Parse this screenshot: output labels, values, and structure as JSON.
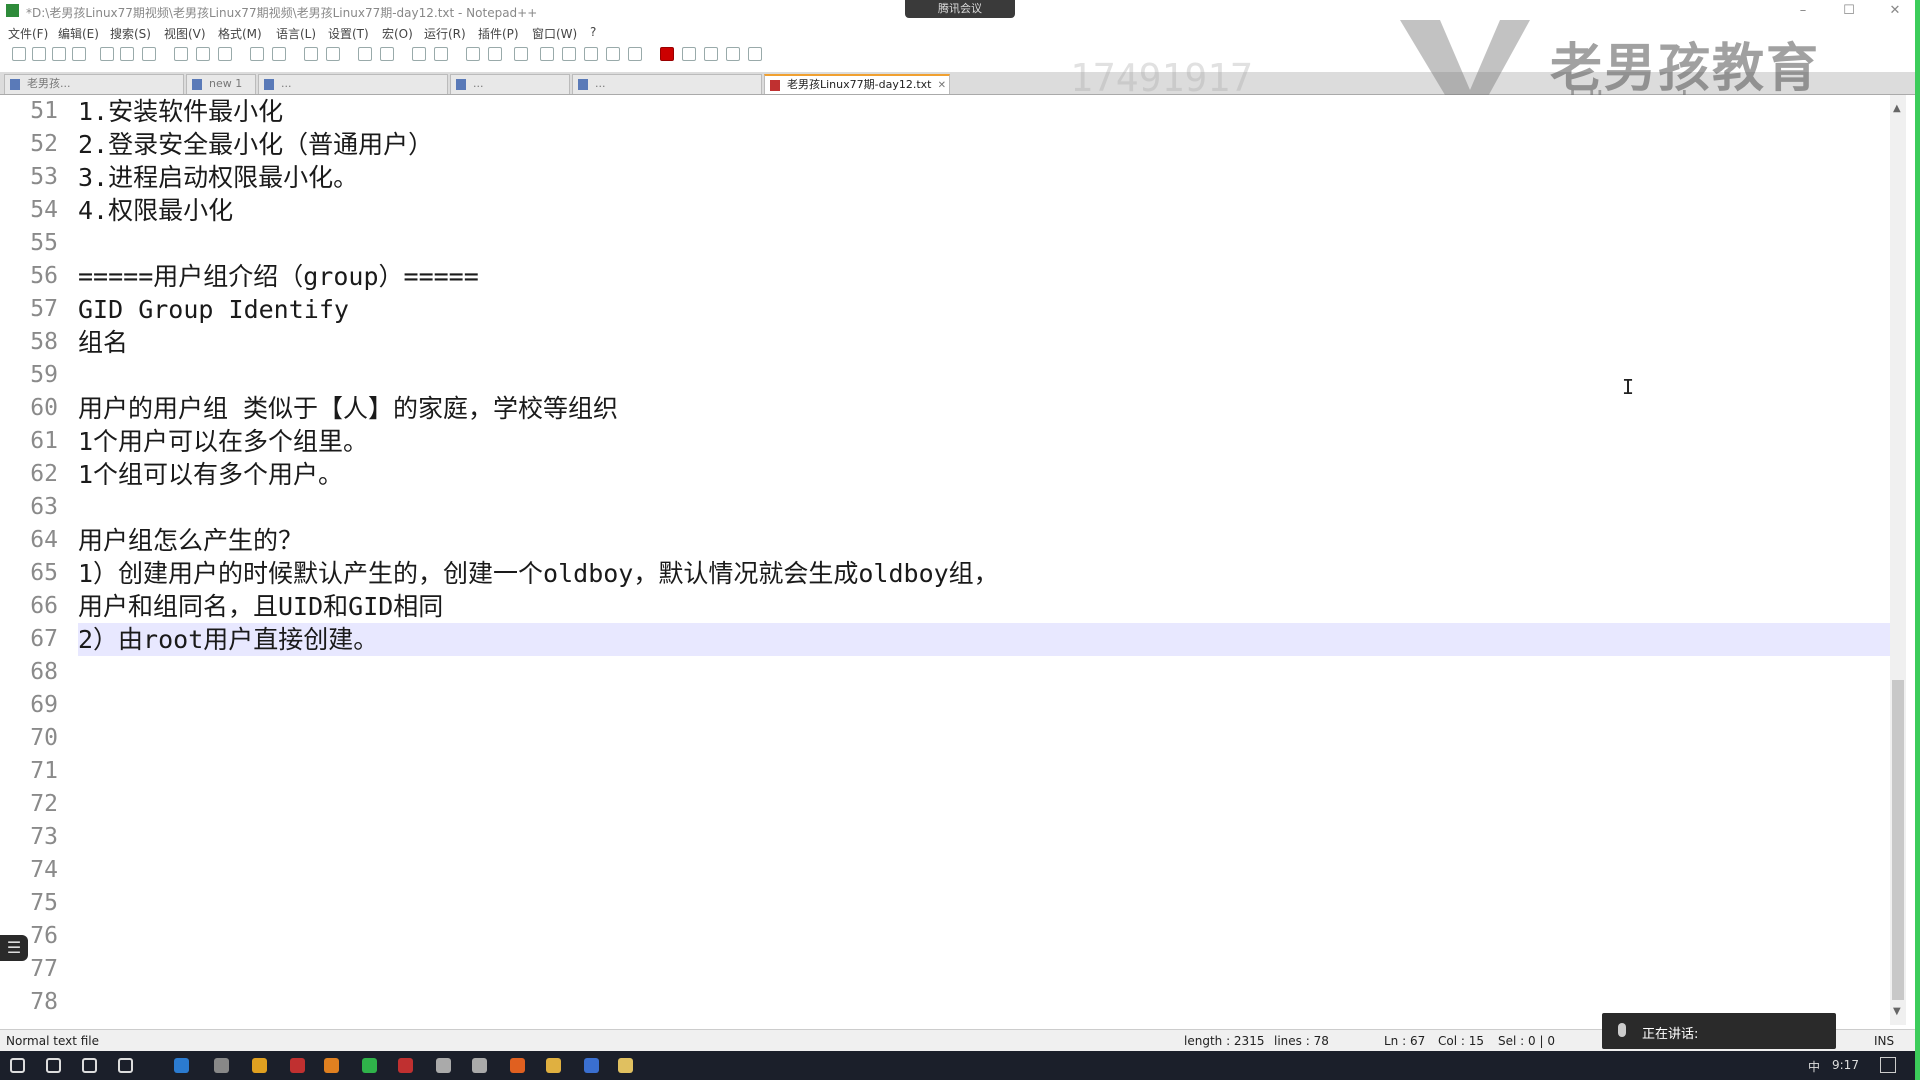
{
  "window": {
    "title": "*D:\\老男孩Linux77期视频\\老男孩Linux77期视频\\老男孩Linux77期-day12.txt - Notepad++",
    "meeting_label": "腾讯会议"
  },
  "menu": [
    "文件(F)",
    "编辑(E)",
    "搜索(S)",
    "视图(V)",
    "格式(M)",
    "语言(L)",
    "设置(T)",
    "宏(O)",
    "运行(R)",
    "插件(P)",
    "窗口(W)",
    "?"
  ],
  "tabs": [
    {
      "label": "老男孩...",
      "active": false
    },
    {
      "label": "new 1",
      "active": false
    },
    {
      "label": "...",
      "active": false
    },
    {
      "label": "...",
      "active": false
    },
    {
      "label": "...",
      "active": false
    },
    {
      "label": "老男孩Linux77期-day12.txt",
      "active": true
    }
  ],
  "watermark": {
    "brand": "老男孩教育",
    "url": "oldboyedu.com",
    "id": "17491917"
  },
  "editor": {
    "current_line": "67",
    "lines": [
      {
        "n": "51",
        "text": "1.安装软件最小化"
      },
      {
        "n": "52",
        "text": "2.登录安全最小化（普通用户）"
      },
      {
        "n": "53",
        "text": "3.进程启动权限最小化。"
      },
      {
        "n": "54",
        "text": "4.权限最小化"
      },
      {
        "n": "55",
        "text": ""
      },
      {
        "n": "56",
        "text": "=====用户组介绍（group）====="
      },
      {
        "n": "57",
        "text": "GID Group Identify"
      },
      {
        "n": "58",
        "text": "组名"
      },
      {
        "n": "59",
        "text": ""
      },
      {
        "n": "60",
        "text": "用户的用户组 类似于【人】的家庭，学校等组织"
      },
      {
        "n": "61",
        "text": "1个用户可以在多个组里。"
      },
      {
        "n": "62",
        "text": "1个组可以有多个用户。"
      },
      {
        "n": "63",
        "text": ""
      },
      {
        "n": "64",
        "text": "用户组怎么产生的？"
      },
      {
        "n": "65",
        "text": "1）创建用户的时候默认产生的，创建一个oldboy，默认情况就会生成oldboy组，"
      },
      {
        "n": "66",
        "text": "用户和组同名，且UID和GID相同"
      },
      {
        "n": "67",
        "text": "2）由root用户直接创建。"
      },
      {
        "n": "68",
        "text": ""
      },
      {
        "n": "69",
        "text": ""
      },
      {
        "n": "70",
        "text": ""
      },
      {
        "n": "71",
        "text": ""
      },
      {
        "n": "72",
        "text": ""
      },
      {
        "n": "73",
        "text": ""
      },
      {
        "n": "74",
        "text": ""
      },
      {
        "n": "75",
        "text": ""
      },
      {
        "n": "76",
        "text": ""
      },
      {
        "n": "77",
        "text": ""
      },
      {
        "n": "78",
        "text": ""
      }
    ]
  },
  "status": {
    "file_type": "Normal text file",
    "length": "length : 2315",
    "lines": "lines : 78",
    "ln": "Ln : 67",
    "col": "Col : 15",
    "sel": "Sel : 0 | 0",
    "mode": "INS"
  },
  "toast": {
    "text": "正在讲话:"
  },
  "taskbar": {
    "time": "9:17",
    "ime": "中",
    "icons": [
      "start-icon",
      "search-icon",
      "cortana-icon",
      "task-view-icon",
      "app-icon",
      "app-icon",
      "chrome-icon",
      "app-icon",
      "app-icon",
      "wechat-icon",
      "app-icon",
      "app-icon",
      "app-icon",
      "app-icon",
      "explorer-icon",
      "app-icon",
      "notepadpp-icon"
    ]
  }
}
